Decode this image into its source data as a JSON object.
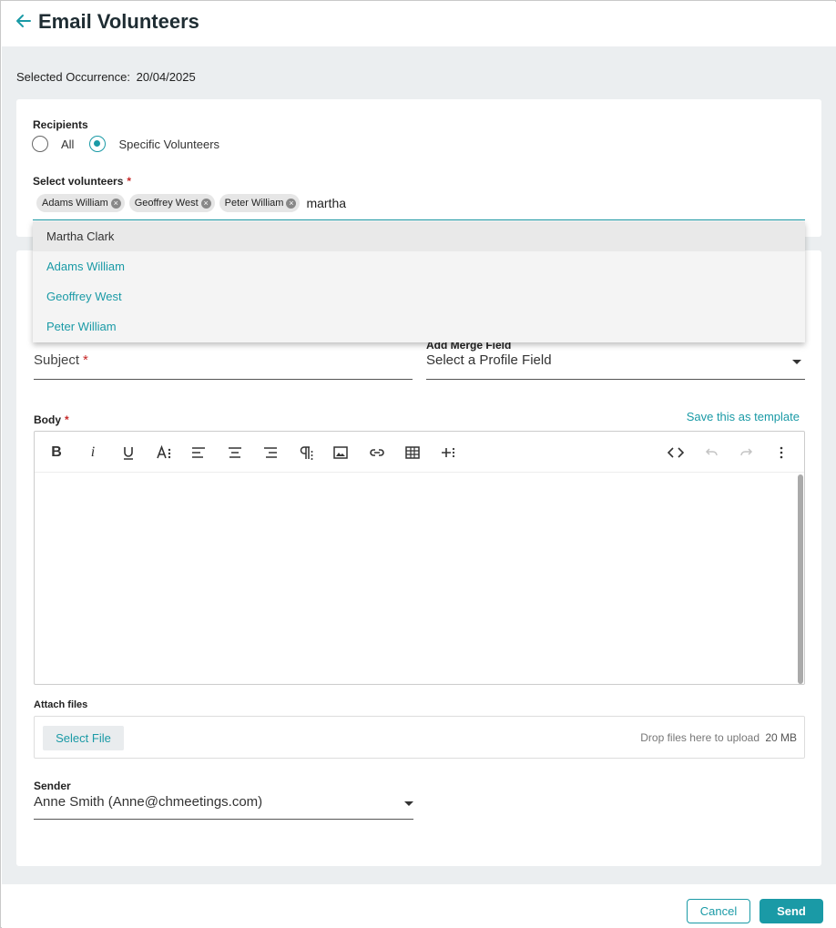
{
  "header": {
    "title": "Email Volunteers"
  },
  "occurrence": {
    "label": "Selected Occurrence:",
    "value": "20/04/2025"
  },
  "recipients": {
    "label": "Recipients",
    "options": [
      {
        "label": "All",
        "checked": false
      },
      {
        "label": "Specific Volunteers",
        "checked": true
      }
    ]
  },
  "volunteers": {
    "label": "Select volunteers",
    "required_mark": "*",
    "chips": [
      "Adams William",
      "Geoffrey West",
      "Peter William"
    ],
    "chip_remove_icon": "x-circle-icon",
    "search_value": "martha",
    "dropdown": [
      "Martha Clark",
      "Adams William",
      "Geoffrey West",
      "Peter William"
    ]
  },
  "subject": {
    "placeholder": "Subject",
    "required_mark": "*"
  },
  "merge": {
    "label": "Add Merge Field",
    "value": "Select a Profile Field"
  },
  "body": {
    "label": "Body",
    "required_mark": "*",
    "save_template": "Save this as template"
  },
  "toolbar_icons": [
    "bold-icon",
    "italic-icon",
    "underline-icon",
    "font-size-icon",
    "align-left-icon",
    "align-center-icon",
    "align-right-icon",
    "paragraph-icon",
    "image-icon",
    "link-icon",
    "table-icon",
    "insert-more-icon",
    "code-view-icon",
    "undo-icon",
    "redo-icon",
    "more-vertical-icon"
  ],
  "attach": {
    "label": "Attach files",
    "button": "Select File",
    "drop_text": "Drop files here to upload",
    "size_limit": "20 MB"
  },
  "sender": {
    "label": "Sender",
    "value": "Anne Smith (Anne@chmeetings.com)"
  },
  "footer": {
    "cancel": "Cancel",
    "send": "Send"
  },
  "colors": {
    "accent": "#1a9aa6",
    "required": "#c62828",
    "background": "#ebeef0"
  }
}
